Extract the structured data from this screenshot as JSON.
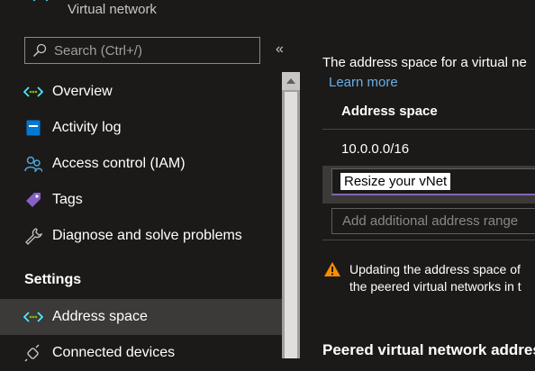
{
  "header": {
    "resource_type": "Virtual network"
  },
  "sidebar": {
    "search_placeholder": "Search (Ctrl+/)",
    "collapse_glyph": "«",
    "items": [
      {
        "label": "Overview",
        "icon": "vnet-icon"
      },
      {
        "label": "Activity log",
        "icon": "activity-log-icon"
      },
      {
        "label": "Access control (IAM)",
        "icon": "people-icon"
      },
      {
        "label": "Tags",
        "icon": "tag-icon"
      },
      {
        "label": "Diagnose and solve problems",
        "icon": "wrench-icon"
      }
    ],
    "section_settings": "Settings",
    "settings_items": [
      {
        "label": "Address space",
        "icon": "vnet-icon",
        "selected": true
      },
      {
        "label": "Connected devices",
        "icon": "plug-icon"
      }
    ]
  },
  "main": {
    "description": "The address space for a virtual ne",
    "learn_more": "Learn more",
    "column_header": "Address space",
    "address": "10.0.0.0/16",
    "tooltip": "Resize your vNet",
    "add_placeholder": "Add additional address range",
    "warning_line1": "Updating the address space of",
    "warning_line2": "the peered virtual networks in t",
    "peered_heading": "Peered virtual network addres"
  },
  "colors": {
    "background": "#1b1a19",
    "accent": "#0078d4",
    "link": "#69afe5",
    "selected": "#3b3a39",
    "warning": "#ff8c00"
  }
}
